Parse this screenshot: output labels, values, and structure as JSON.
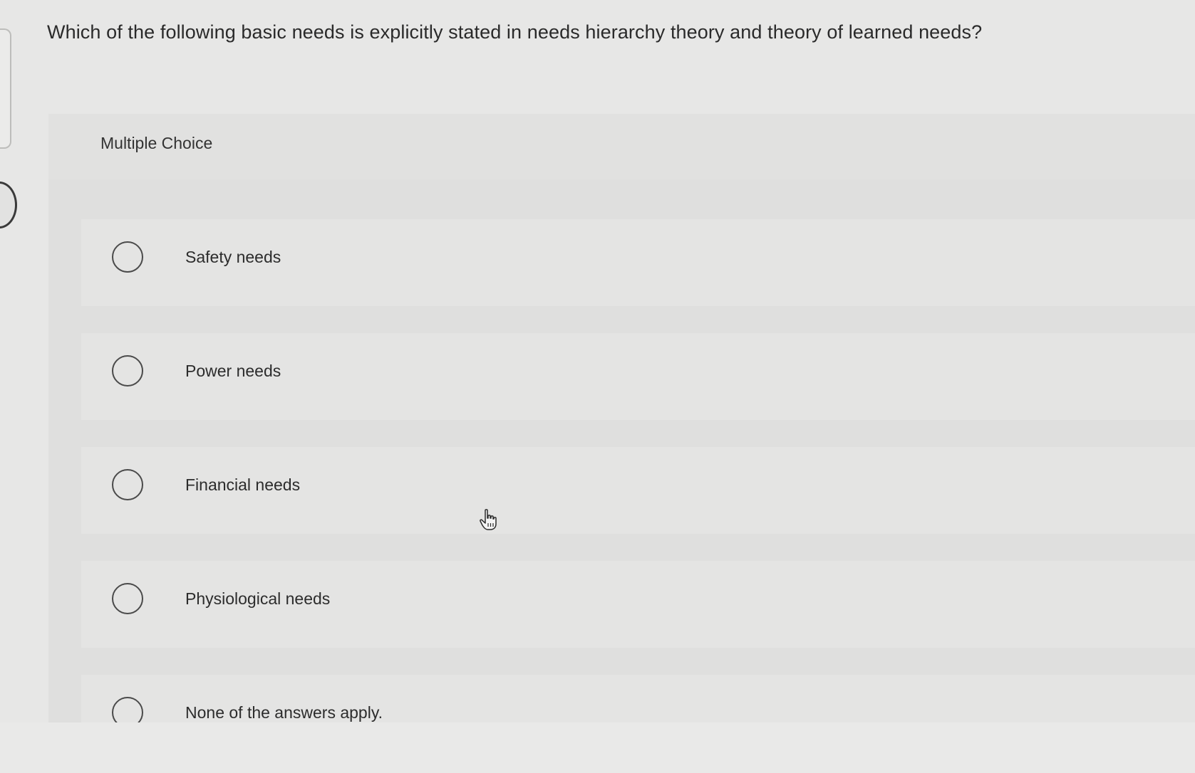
{
  "question": {
    "text": "Which of the following basic needs is explicitly stated in needs hierarchy theory and theory of learned needs?"
  },
  "panel": {
    "label": "Multiple Choice"
  },
  "options": [
    {
      "label": "Safety needs"
    },
    {
      "label": "Power needs"
    },
    {
      "label": "Financial needs"
    },
    {
      "label": "Physiological needs"
    },
    {
      "label": "None of the answers apply."
    }
  ],
  "cursor": {
    "icon": "hand-pointer-icon"
  }
}
